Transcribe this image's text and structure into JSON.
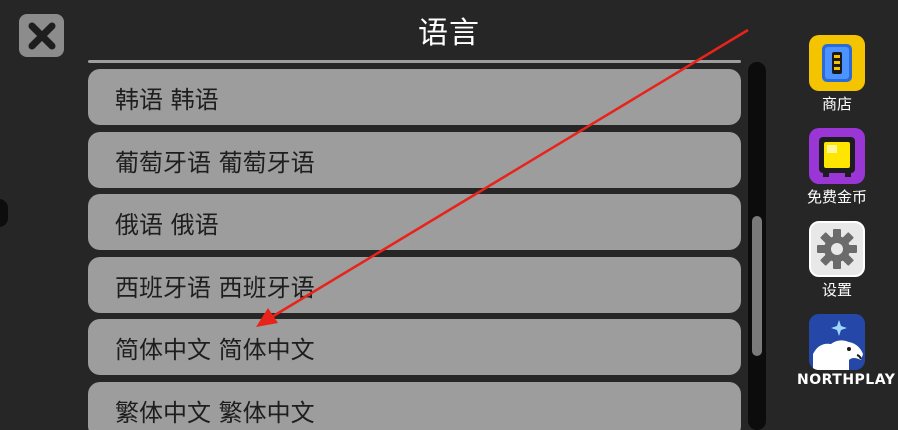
{
  "header": {
    "title": "语言"
  },
  "languages": [
    {
      "label": "韩语 韩语"
    },
    {
      "label": "葡萄牙语 葡萄牙语"
    },
    {
      "label": "俄语 俄语"
    },
    {
      "label": "西班牙语 西班牙语"
    },
    {
      "label": "简体中文 简体中文"
    },
    {
      "label": "繁体中文 繁体中文"
    }
  ],
  "sidebar": {
    "shop_label": "商店",
    "free_coins_label": "免费金币",
    "settings_label": "设置",
    "brand_label": "NORTHPLAY"
  },
  "icons": {
    "close": "close-icon",
    "shop": "shop-icon",
    "free_coins": "tv-icon",
    "settings": "gear-icon",
    "brand": "polar-bear-logo"
  },
  "colors": {
    "background": "#262626",
    "row": "#9d9d9d",
    "shop_tile": "#f5c400",
    "coins_tile": "#9a35d6",
    "annotation_arrow": "#e8231b"
  }
}
